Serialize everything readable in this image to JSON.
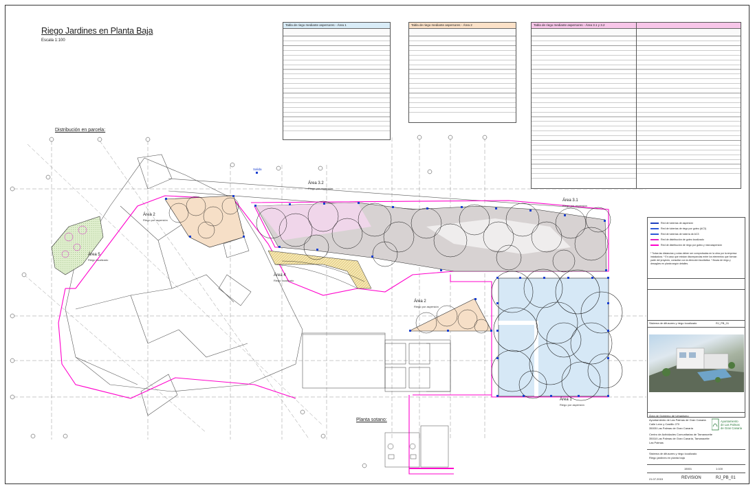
{
  "drawing": {
    "title": "Riego Jardines en Planta Baja",
    "scale": "Escala 1:100",
    "distribution_label": "Distribución en parcela:",
    "plant_label": "Planta sotano:",
    "entrance_label": "Salida"
  },
  "tables": [
    {
      "caption": "Tabla de riego mediante aspersores - Área 1",
      "header_color": "#d9ecf7",
      "rows": 22
    },
    {
      "caption": "Tabla de riego mediante aspersores - Área 2",
      "header_color": "#fbe1c8",
      "rows": 17
    },
    {
      "caption": "Tabla de riego mediante aspersores - Área 3.1 y 3.2",
      "header_color": "#f7c6e8",
      "rows": 32
    },
    {
      "caption": "",
      "header_color": "#f7c6e8",
      "rows": 30
    }
  ],
  "areas": [
    {
      "name": "Área 1",
      "desc": "Riego por aspersión"
    },
    {
      "name": "Área 2",
      "desc": "Riego por aspersión"
    },
    {
      "name": "Área 3",
      "desc": "Riego localizado"
    },
    {
      "name": "Área 4",
      "desc": "Riego localizado"
    },
    {
      "name": "Área 3.1",
      "desc": "Riego por aspersión"
    },
    {
      "name": "Área 3.2",
      "desc": "Riego por aspersión"
    },
    {
      "name": "Área 5",
      "desc": "Riego localizado"
    }
  ],
  "legend": {
    "items": [
      {
        "label": "Red de tuberías de aspersión",
        "color": "#1d3fbf"
      },
      {
        "label": "Red de tuberías de riego por goteo (AC3)",
        "color": "#2b57d6"
      },
      {
        "label": "Red de tuberías de tubería de AC3",
        "color": "#2b57d6"
      },
      {
        "label": "Red de distribución de goteo localizado",
        "color": "#e020c0"
      },
      {
        "label": "Red de distribución de riego por goteo y microaspersión",
        "color": "#ff00cc"
      }
    ],
    "note": "* Todas las distancias y cotas deben ser comprobadas en la obra por la empresa instaladora. * En caso que existan discrepancias entre los elementos que forman parte del proyecto, consultar con la dirección facultativa. * Bocas de riego y desagües en planta según detalles."
  },
  "title_block": {
    "project_line": "Sistema de difusores y riego localizado",
    "code": "RJ_PB_01",
    "office": "Área de Gobierno de Urbanismo",
    "org": "Ayuntamiento de Las Palmas de Gran Canaria",
    "address1": "Calle León y Castillo 270",
    "address2": "35005 Las Palmas de Gran Canaria",
    "centre": "Centro de Actividades Comunitarias de Tamaraceite",
    "centre_addr": "35018 Las Palmas de Gran Canaria, Tamaraceite",
    "city": "Las Palmas",
    "sheet_title1": "Sistema de difusores y riego localizado",
    "sheet_title2": "Riego jardines en planta baja",
    "num": "15001",
    "sheet_scale": "1:100",
    "date": "21.07.2015",
    "revision": "REVISION",
    "sheet_code": "RJ_PB_01",
    "logo_name": "Ayuntamiento de Las Palmas de Gran Canaria"
  }
}
